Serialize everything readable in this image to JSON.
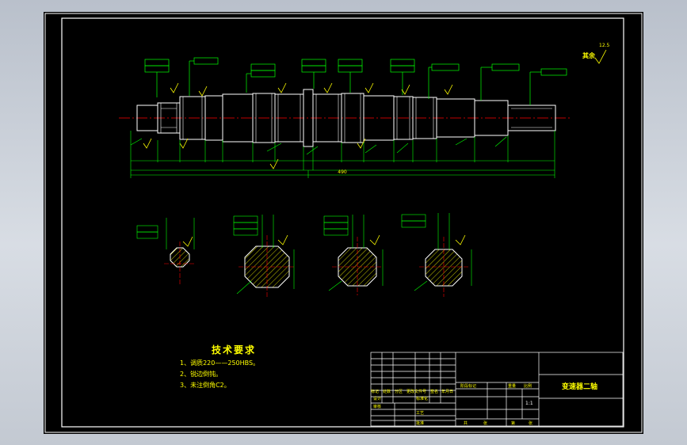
{
  "drawing": {
    "title": "变速器二轴",
    "scale": "1:1",
    "roughness_note": "其余",
    "roughness_value": "12.5",
    "overall_length": "490"
  },
  "tech_requirements": {
    "heading": "技术要求",
    "items": [
      "1、调质220——250HBS。",
      "2、锐边倒钝。",
      "3、未注倒角C2。"
    ]
  },
  "title_block": {
    "labels": [
      "标记",
      "处数",
      "分区",
      "更改文件号",
      "签名",
      "年月日",
      "设计",
      "标准化",
      "阶段标记",
      "重量",
      "比例",
      "审核",
      "工艺",
      "批准",
      "共",
      "张",
      "第",
      "张"
    ]
  },
  "colors": {
    "background": "#000000",
    "line": "#ffffff",
    "dimension": "#00ff00",
    "centerline": "#ff0000",
    "hatch": "#ffff00",
    "text": "#ffff00",
    "title_block": "#ffffff"
  }
}
